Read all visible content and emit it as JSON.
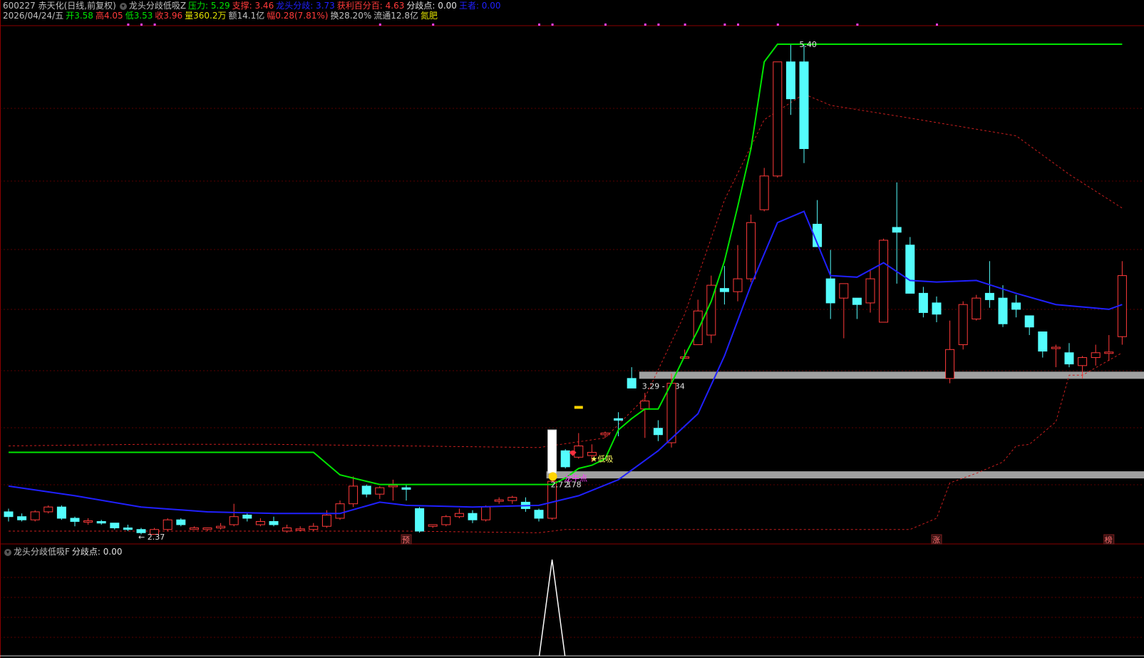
{
  "header": {
    "line1": [
      {
        "text": "600227 赤天化(日线,前复权)",
        "color": "#c0c0c0"
      },
      {
        "text": "龙头分歧低吸Z",
        "color": "#c0c0c0",
        "button": true
      },
      {
        "text": "压力: 5.29",
        "color": "#00e400"
      },
      {
        "text": "支撑: 3.46",
        "color": "#ff3a3a"
      },
      {
        "text": "龙头分歧: 3.73",
        "color": "#2020ff"
      },
      {
        "text": "获利百分百: 4.63",
        "color": "#ff3a3a"
      },
      {
        "text": "分歧点: 0.00",
        "color": "#e0e0e0"
      },
      {
        "text": "王者: 0.00",
        "color": "#2020ff"
      }
    ],
    "line2": [
      {
        "text": "2026/04/24/五",
        "color": "#c0c0c0"
      },
      {
        "text": "开3.58",
        "color": "#00e400"
      },
      {
        "text": "高4.05",
        "color": "#ff3a3a"
      },
      {
        "text": "低3.53",
        "color": "#00e400"
      },
      {
        "text": "收3.96",
        "color": "#ff3a3a"
      },
      {
        "text": "量360.2万",
        "color": "#e0e000"
      },
      {
        "text": "额14.1亿",
        "color": "#c0c0c0"
      },
      {
        "text": "幅0.28(7.81%)",
        "color": "#ff3a3a"
      },
      {
        "text": "换28.20%",
        "color": "#c0c0c0"
      },
      {
        "text": "流通12.8亿",
        "color": "#c0c0c0"
      },
      {
        "text": "氮肥",
        "color": "#e0e000"
      }
    ],
    "sub_panel": [
      {
        "text": "龙头分歧低吸F",
        "color": "#c0c0c0",
        "button": true
      },
      {
        "text": "分歧点: 0.00",
        "color": "#e0e0e0"
      }
    ]
  },
  "colors": {
    "up": "#ff3a3a",
    "down": "#54fcfc",
    "ma_blue": "#2020ff",
    "green_line": "#00e400",
    "dashed": "#c81e1e",
    "support_band": "#a0a0a0",
    "grid": "#5a0000"
  },
  "chart_data": {
    "type": "candlestick",
    "price_range": [
      2.37,
      5.4
    ],
    "high_label": "5.40",
    "low_label": "2.37",
    "candles": [
      [
        2.49,
        2.51,
        2.43,
        2.46
      ],
      [
        2.46,
        2.48,
        2.43,
        2.44
      ],
      [
        2.44,
        2.5,
        2.43,
        2.49
      ],
      [
        2.49,
        2.53,
        2.48,
        2.52
      ],
      [
        2.52,
        2.53,
        2.44,
        2.45
      ],
      [
        2.45,
        2.46,
        2.4,
        2.43
      ],
      [
        2.43,
        2.45,
        2.41,
        2.43
      ],
      [
        2.43,
        2.44,
        2.41,
        2.42
      ],
      [
        2.42,
        2.42,
        2.38,
        2.39
      ],
      [
        2.39,
        2.41,
        2.37,
        2.38
      ],
      [
        2.38,
        2.39,
        2.35,
        2.36
      ],
      [
        2.35,
        2.39,
        2.35,
        2.38
      ],
      [
        2.38,
        2.45,
        2.37,
        2.44
      ],
      [
        2.44,
        2.45,
        2.4,
        2.41
      ],
      [
        2.38,
        2.4,
        2.38,
        2.39
      ],
      [
        2.38,
        2.39,
        2.37,
        2.39
      ],
      [
        2.39,
        2.42,
        2.38,
        2.4
      ],
      [
        2.41,
        2.54,
        2.4,
        2.46
      ],
      [
        2.47,
        2.48,
        2.43,
        2.45
      ],
      [
        2.41,
        2.45,
        2.4,
        2.43
      ],
      [
        2.43,
        2.46,
        2.4,
        2.41
      ],
      [
        2.37,
        2.41,
        2.36,
        2.39
      ],
      [
        2.38,
        2.4,
        2.37,
        2.38
      ],
      [
        2.38,
        2.42,
        2.37,
        2.4
      ],
      [
        2.4,
        2.5,
        2.39,
        2.47
      ],
      [
        2.45,
        2.56,
        2.44,
        2.54
      ],
      [
        2.54,
        2.71,
        2.52,
        2.65
      ],
      [
        2.65,
        2.66,
        2.58,
        2.6
      ],
      [
        2.6,
        2.65,
        2.57,
        2.64
      ],
      [
        2.65,
        2.69,
        2.56,
        2.65
      ],
      [
        2.64,
        2.66,
        2.56,
        2.63
      ],
      [
        2.51,
        2.52,
        2.36,
        2.37
      ],
      [
        2.4,
        2.41,
        2.39,
        2.41
      ],
      [
        2.41,
        2.47,
        2.4,
        2.46
      ],
      [
        2.46,
        2.51,
        2.45,
        2.48
      ],
      [
        2.48,
        2.5,
        2.42,
        2.44
      ],
      [
        2.44,
        2.53,
        2.43,
        2.52
      ],
      [
        2.56,
        2.58,
        2.54,
        2.56
      ],
      [
        2.56,
        2.59,
        2.54,
        2.58
      ],
      [
        2.55,
        2.58,
        2.49,
        2.51
      ],
      [
        2.5,
        2.51,
        2.43,
        2.45
      ],
      [
        2.45,
        2.73,
        2.44,
        2.68
      ],
      [
        2.87,
        2.88,
        2.76,
        2.77
      ],
      [
        2.83,
        2.98,
        2.82,
        2.9
      ],
      [
        2.84,
        2.91,
        2.8,
        2.86
      ],
      [
        2.97,
        2.99,
        2.95,
        2.98
      ],
      [
        3.07,
        3.11,
        2.96,
        3.06
      ],
      [
        3.32,
        3.39,
        3.28,
        3.26
      ],
      [
        3.13,
        3.23,
        2.95,
        3.18
      ],
      [
        3.01,
        3.06,
        2.93,
        2.97
      ],
      [
        2.92,
        3.35,
        2.89,
        3.29
      ],
      [
        3.45,
        3.5,
        3.45,
        3.45
      ],
      [
        3.53,
        3.81,
        3.53,
        3.74
      ],
      [
        3.59,
        3.96,
        3.54,
        3.9
      ],
      [
        3.88,
        4.02,
        3.78,
        3.86
      ],
      [
        3.86,
        4.15,
        3.8,
        3.94
      ],
      [
        3.94,
        4.34,
        3.92,
        4.29
      ],
      [
        4.37,
        4.63,
        4.36,
        4.58
      ],
      [
        4.58,
        5.29,
        4.57,
        5.29
      ],
      [
        5.29,
        5.4,
        4.96,
        5.06
      ],
      [
        5.29,
        5.4,
        4.66,
        4.75
      ],
      [
        4.28,
        4.43,
        4.14,
        4.14
      ],
      [
        3.94,
        4.12,
        3.69,
        3.79
      ],
      [
        3.82,
        3.91,
        3.57,
        3.91
      ],
      [
        3.82,
        3.82,
        3.69,
        3.78
      ],
      [
        3.79,
        4.0,
        3.73,
        3.94
      ],
      [
        3.67,
        4.19,
        3.67,
        4.18
      ],
      [
        4.26,
        4.54,
        3.91,
        4.23
      ],
      [
        4.15,
        4.2,
        3.86,
        3.85
      ],
      [
        3.85,
        3.89,
        3.7,
        3.73
      ],
      [
        3.79,
        3.83,
        3.67,
        3.72
      ],
      [
        3.32,
        3.68,
        3.29,
        3.5
      ],
      [
        3.53,
        3.8,
        3.5,
        3.78
      ],
      [
        3.69,
        3.84,
        3.68,
        3.82
      ],
      [
        3.85,
        4.05,
        3.76,
        3.81
      ],
      [
        3.82,
        3.9,
        3.64,
        3.66
      ],
      [
        3.79,
        3.84,
        3.7,
        3.75
      ],
      [
        3.71,
        3.71,
        3.59,
        3.64
      ],
      [
        3.61,
        3.61,
        3.45,
        3.49
      ],
      [
        3.51,
        3.53,
        3.39,
        3.51
      ],
      [
        3.48,
        3.54,
        3.39,
        3.41
      ],
      [
        3.4,
        3.46,
        3.32,
        3.45
      ],
      [
        3.45,
        3.53,
        3.4,
        3.48
      ],
      [
        3.48,
        3.59,
        3.43,
        3.48
      ],
      [
        3.58,
        4.05,
        3.53,
        3.96
      ]
    ],
    "green_line": [
      [
        0,
        2.86
      ],
      [
        23,
        2.86
      ],
      [
        25,
        2.72
      ],
      [
        28,
        2.66
      ],
      [
        35,
        2.66
      ],
      [
        41,
        2.66
      ],
      [
        42,
        2.7
      ],
      [
        43,
        2.76
      ],
      [
        44,
        2.78
      ],
      [
        45,
        2.82
      ],
      [
        46,
        3.0
      ],
      [
        47,
        3.07
      ],
      [
        48,
        3.13
      ],
      [
        49,
        3.13
      ],
      [
        50,
        3.29
      ],
      [
        51,
        3.46
      ],
      [
        52,
        3.62
      ],
      [
        53,
        3.8
      ],
      [
        54,
        4.05
      ],
      [
        55,
        4.39
      ],
      [
        56,
        4.75
      ],
      [
        57,
        5.29
      ],
      [
        58,
        5.4
      ],
      [
        84,
        5.4
      ]
    ],
    "blue_ma": [
      [
        0,
        2.65
      ],
      [
        5,
        2.59
      ],
      [
        10,
        2.52
      ],
      [
        15,
        2.49
      ],
      [
        20,
        2.48
      ],
      [
        25,
        2.48
      ],
      [
        28,
        2.55
      ],
      [
        30,
        2.53
      ],
      [
        35,
        2.52
      ],
      [
        40,
        2.53
      ],
      [
        43,
        2.59
      ],
      [
        46,
        2.69
      ],
      [
        49,
        2.87
      ],
      [
        52,
        3.1
      ],
      [
        54,
        3.46
      ],
      [
        56,
        3.9
      ],
      [
        58,
        4.29
      ],
      [
        60,
        4.36
      ],
      [
        62,
        3.96
      ],
      [
        64,
        3.95
      ],
      [
        66,
        4.04
      ],
      [
        68,
        3.93
      ],
      [
        70,
        3.92
      ],
      [
        73,
        3.93
      ],
      [
        76,
        3.85
      ],
      [
        79,
        3.78
      ],
      [
        83,
        3.75
      ],
      [
        84,
        3.78
      ]
    ],
    "upper_dashed": [
      [
        0,
        2.9
      ],
      [
        10,
        2.91
      ],
      [
        20,
        2.91
      ],
      [
        30,
        2.9
      ],
      [
        40,
        2.89
      ],
      [
        45,
        2.95
      ],
      [
        48,
        3.2
      ],
      [
        51,
        3.72
      ],
      [
        54,
        4.43
      ],
      [
        57,
        4.93
      ],
      [
        60,
        5.09
      ],
      [
        62,
        5.02
      ],
      [
        68,
        4.94
      ],
      [
        76,
        4.83
      ],
      [
        80,
        4.59
      ],
      [
        84,
        4.38
      ]
    ],
    "lower_dashed": [
      [
        0,
        2.37
      ],
      [
        10,
        2.37
      ],
      [
        20,
        2.37
      ],
      [
        30,
        2.37
      ],
      [
        40,
        2.36
      ],
      [
        42,
        2.38
      ],
      [
        50,
        2.38
      ],
      [
        60,
        2.38
      ],
      [
        68,
        2.38
      ],
      [
        70,
        2.45
      ],
      [
        71,
        2.67
      ],
      [
        73,
        2.73
      ],
      [
        75,
        2.8
      ],
      [
        76,
        2.9
      ],
      [
        77,
        2.91
      ],
      [
        79,
        3.05
      ],
      [
        80,
        3.34
      ],
      [
        81,
        3.34
      ],
      [
        84,
        3.48
      ]
    ],
    "support_bands": [
      {
        "start_index": 48,
        "price": 3.34,
        "label": "3.29 - 3.34"
      },
      {
        "start_index": 41,
        "price": 2.72,
        "label": ""
      }
    ],
    "annotations": [
      {
        "text": "★低吸",
        "index": 44,
        "price": 2.82,
        "color": "#ffff60"
      },
      {
        "text": "2.78",
        "index": 42,
        "price": 2.66,
        "color": "#e0e0e0"
      },
      {
        "text": "2.7 3",
        "index": 41,
        "price": 2.66,
        "color": "#e0e0e0"
      },
      {
        "text": "龙牛点",
        "index": 42,
        "price": 2.7,
        "color": "#ff40ff"
      }
    ],
    "bottom_labels": [
      {
        "text": "预",
        "index": 30
      },
      {
        "text": "涨",
        "index": 70
      },
      {
        "text": "榜",
        "index": 83
      }
    ],
    "top_markers": [
      9,
      10,
      11,
      28,
      32,
      40,
      41,
      45,
      48,
      49,
      51,
      54,
      55,
      58,
      64,
      70
    ],
    "subpanel": {
      "spike_index": 41,
      "spike_value": 1,
      "baseline": 0
    }
  }
}
